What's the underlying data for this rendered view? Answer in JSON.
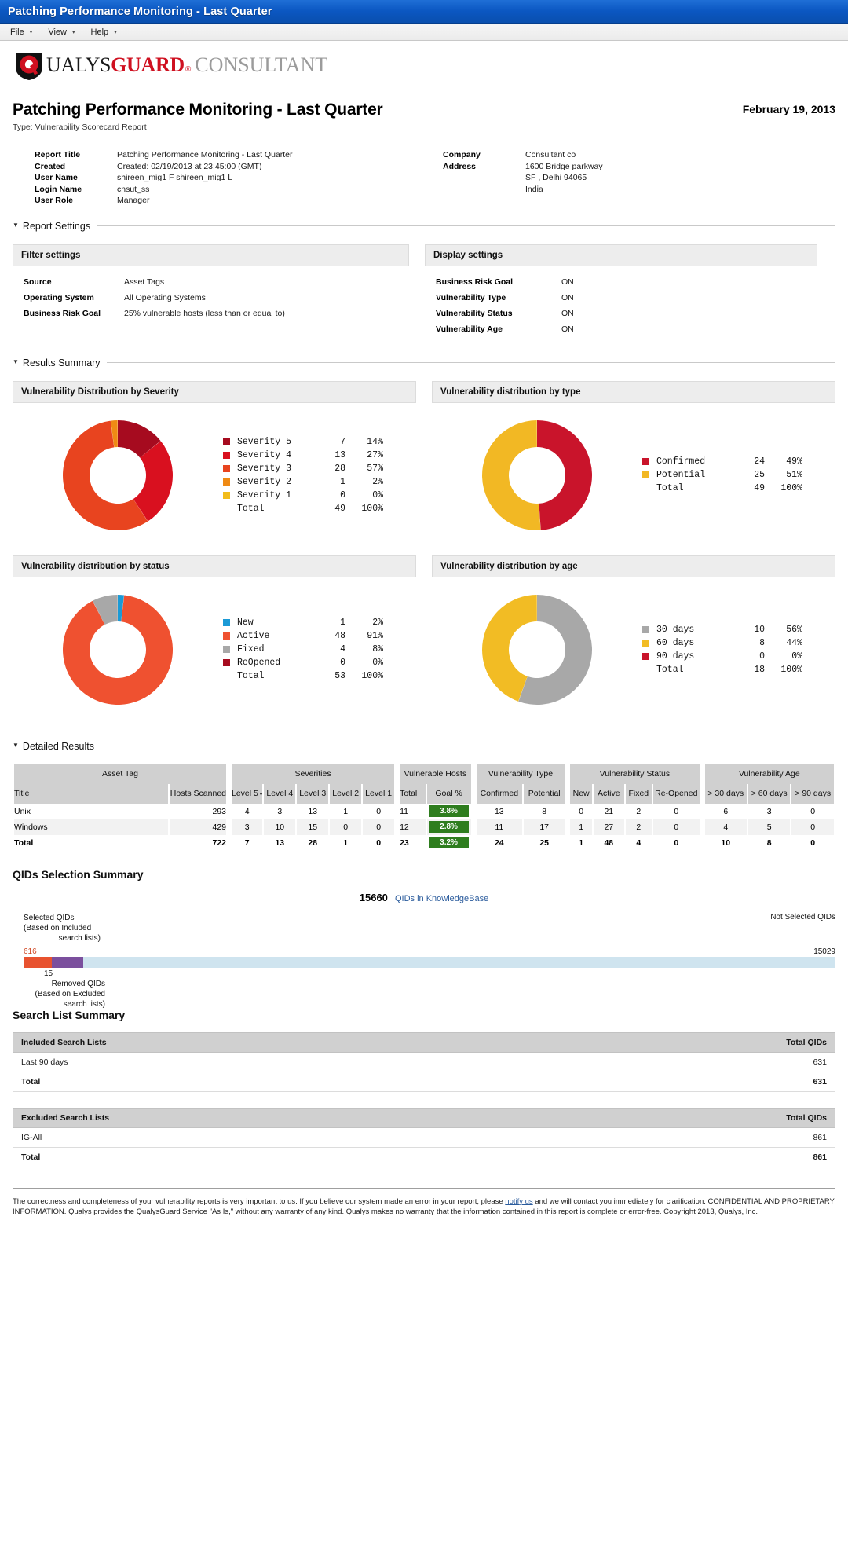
{
  "window": {
    "title": "Patching Performance Monitoring - Last Quarter"
  },
  "menubar": {
    "items": [
      {
        "label": "File",
        "caret": "▾"
      },
      {
        "label": "View",
        "caret": "▾"
      },
      {
        "label": "Help",
        "caret": "▾"
      }
    ]
  },
  "brand": {
    "qualys": "Q",
    "qualys_rest": "UALYS",
    "guard": "GUARD",
    "reg": "®",
    "consultant": "CONSULTANT",
    "logo_icon": "qualys-shield-icon"
  },
  "report": {
    "title": "Patching Performance Monitoring - Last Quarter",
    "type": "Type: Vulnerability Scorecard Report",
    "date": "February 19, 2013"
  },
  "meta": {
    "left": [
      {
        "label": "Report Title",
        "value": "Patching Performance Monitoring - Last Quarter"
      },
      {
        "label": "Created",
        "value": "Created: 02/19/2013 at 23:45:00 (GMT)"
      },
      {
        "label": "User Name",
        "value": "shireen_mig1 F shireen_mig1 L"
      },
      {
        "label": "Login Name",
        "value": "cnsut_ss"
      },
      {
        "label": "User Role",
        "value": "Manager"
      }
    ],
    "right": [
      {
        "label": "Company",
        "value": "Consultant co"
      },
      {
        "label": "Address",
        "value": "1600 Bridge parkway"
      },
      {
        "label": "",
        "value": "SF ,  Delhi  94065"
      },
      {
        "label": "",
        "value": "India"
      }
    ]
  },
  "sections": {
    "report_settings": "Report Settings",
    "results_summary": "Results Summary",
    "detailed_results": "Detailed Results"
  },
  "filter_settings": {
    "heading": "Filter settings",
    "rows": [
      {
        "k": "Source",
        "v": "Asset Tags"
      },
      {
        "k": "Operating System",
        "v": "All Operating Systems"
      },
      {
        "k": "Business Risk Goal",
        "v": "25% vulnerable hosts (less than or equal to)"
      }
    ]
  },
  "display_settings": {
    "heading": "Display settings",
    "rows": [
      {
        "k": "Business Risk Goal",
        "v": "ON"
      },
      {
        "k": "Vulnerability Type",
        "v": "ON"
      },
      {
        "k": "Vulnerability Status",
        "v": "ON"
      },
      {
        "k": "Vulnerability Age",
        "v": "ON"
      }
    ]
  },
  "chart_data": [
    {
      "type": "pie",
      "title": "Vulnerability Distribution by Severity",
      "legend_position": "right",
      "total_label": "Total",
      "total_value": 49,
      "total_percent": "100%",
      "categories": [
        "Severity 5",
        "Severity 4",
        "Severity 3",
        "Severity 2",
        "Severity 1"
      ],
      "values": [
        7,
        13,
        28,
        1,
        0
      ],
      "percents": [
        "14%",
        "27%",
        "57%",
        "2%",
        "0%"
      ],
      "colors": [
        "#a60b1f",
        "#d9101f",
        "#e8441f",
        "#ef8a14",
        "#f2bc1b"
      ]
    },
    {
      "type": "pie",
      "title": "Vulnerability distribution by type",
      "legend_position": "right",
      "total_label": "Total",
      "total_value": 49,
      "total_percent": "100%",
      "categories": [
        "Confirmed",
        "Potential"
      ],
      "values": [
        24,
        25
      ],
      "percents": [
        "49%",
        "51%"
      ],
      "colors": [
        "#c9142b",
        "#f2b824"
      ]
    },
    {
      "type": "pie",
      "title": "Vulnerability distribution by status",
      "legend_position": "right",
      "total_label": "Total",
      "total_value": 53,
      "total_percent": "100%",
      "categories": [
        "New",
        "Active",
        "Fixed",
        "ReOpened"
      ],
      "values": [
        1,
        48,
        4,
        0
      ],
      "percents": [
        "2%",
        "91%",
        "8%",
        "0%"
      ],
      "colors": [
        "#1b9ad6",
        "#ef5130",
        "#a8a8a8",
        "#a60b1f"
      ]
    },
    {
      "type": "pie",
      "title": "Vulnerability distribution by age",
      "legend_position": "right",
      "total_label": "Total",
      "total_value": 18,
      "total_percent": "100%",
      "categories": [
        "30 days",
        "60 days",
        "90 days"
      ],
      "values": [
        10,
        8,
        0
      ],
      "percents": [
        "56%",
        "44%",
        "0%"
      ],
      "colors": [
        "#a8a8a8",
        "#f2bc24",
        "#c9142b"
      ]
    }
  ],
  "detailed_results": {
    "groups": [
      {
        "label": "Asset Tag",
        "span": 2
      },
      {
        "label": "Severities",
        "span": 5
      },
      {
        "label": "Vulnerable Hosts",
        "span": 2
      },
      {
        "label": "Vulnerability Type",
        "span": 2
      },
      {
        "label": "Vulnerability Status",
        "span": 4
      },
      {
        "label": "Vulnerability Age",
        "span": 3
      }
    ],
    "subheaders": [
      "Title",
      "Hosts Scanned",
      "Level 5",
      "Level 4",
      "Level 3",
      "Level 2",
      "Level 1",
      "Total",
      "Goal %",
      "Confirmed",
      "Potential",
      "New",
      "Active",
      "Fixed",
      "Re-Opened",
      "> 30 days",
      "> 60 days",
      "> 90 days"
    ],
    "sort_caret": "▾",
    "rows": [
      {
        "title": "Unix",
        "hosts": "293",
        "sev": [
          "4",
          "3",
          "13",
          "1",
          "0"
        ],
        "vh_total": "11",
        "goal": "3.8%",
        "type": [
          "13",
          "8"
        ],
        "status": [
          "0",
          "21",
          "2",
          "0"
        ],
        "age": [
          "6",
          "3",
          "0"
        ]
      },
      {
        "title": "Windows",
        "hosts": "429",
        "sev": [
          "3",
          "10",
          "15",
          "0",
          "0"
        ],
        "vh_total": "12",
        "goal": "2.8%",
        "type": [
          "11",
          "17"
        ],
        "status": [
          "1",
          "27",
          "2",
          "0"
        ],
        "age": [
          "4",
          "5",
          "0"
        ]
      }
    ],
    "total": {
      "title": "Total",
      "hosts": "722",
      "sev": [
        "7",
        "13",
        "28",
        "1",
        "0"
      ],
      "vh_total": "23",
      "goal": "3.2%",
      "type": [
        "24",
        "25"
      ],
      "status": [
        "1",
        "48",
        "4",
        "0"
      ],
      "age": [
        "10",
        "8",
        "0"
      ]
    }
  },
  "qids": {
    "heading": "QIDs Selection Summary",
    "kb_count": "15660",
    "kb_label": "QIDs in KnowledgeBase",
    "selected_label_l1": "Selected QIDs",
    "selected_label_l2": "(Based on Included",
    "selected_label_l3": "search lists)",
    "selected_count": "616",
    "not_selected_label": "Not Selected QIDs",
    "not_selected_count": "15029",
    "removed_count": "15",
    "removed_label_l1": "Removed QIDs",
    "removed_label_l2": "(Based on Excluded",
    "removed_label_l3": "search lists)",
    "bar_colors": {
      "selected": "#e8522f",
      "removed": "#7b4f9d",
      "not_selected": "#cfe4ef"
    }
  },
  "search_lists": {
    "heading": "Search List Summary",
    "included": {
      "col1": "Included Search Lists",
      "col2": "Total QIDs",
      "rows": [
        {
          "name": "Last 90 days",
          "qids": "631"
        }
      ],
      "total": {
        "name": "Total",
        "qids": "631"
      }
    },
    "excluded": {
      "col1": "Excluded Search Lists",
      "col2": "Total QIDs",
      "rows": [
        {
          "name": "IG-All",
          "qids": "861"
        }
      ],
      "total": {
        "name": "Total",
        "qids": "861"
      }
    }
  },
  "footer": {
    "p1a": "The correctness and completeness of your vulnerability reports is very important to us. If you believe our system made an error in your report, please ",
    "link": "notify us",
    "p1b": " and we will contact you immediately for clarification.",
    "p2": "CONFIDENTIAL AND PROPRIETARY INFORMATION. Qualys provides the QualysGuard Service \"As Is,\" without any warranty of any kind. Qualys makes no warranty that the information contained in this report is complete or error-free. Copyright 2013, Qualys, Inc."
  }
}
